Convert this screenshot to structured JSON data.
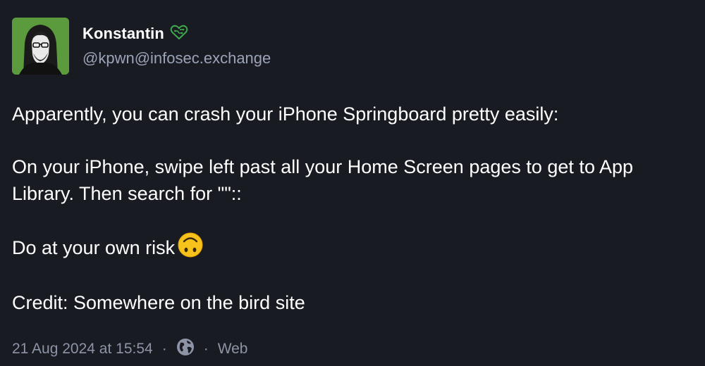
{
  "author": {
    "display_name": "Konstantin",
    "handle": "@kpwn@infosec.exchange",
    "badge_icon": "heart-circuit-icon",
    "avatar_bg": "#5a9a3c"
  },
  "post": {
    "paragraphs": [
      "Apparently, you can crash your iPhone Springboard pretty easily:",
      "On your iPhone, swipe left past all your Home Screen pages to get to App Library. Then search for \"\"::",
      "Do at your own risk",
      "Credit: Somewhere on the bird site"
    ],
    "emoji_icon": "upside-down-face-icon"
  },
  "meta": {
    "timestamp": "21 Aug 2024 at 15:54",
    "separator": "·",
    "visibility_icon": "globe-icon",
    "client": "Web"
  },
  "colors": {
    "background": "#191b22",
    "text": "#ffffff",
    "muted": "#8c94a6",
    "handle": "#9ba3b8",
    "badge_green": "#3fa84a",
    "emoji_yellow": "#f8c21c"
  }
}
